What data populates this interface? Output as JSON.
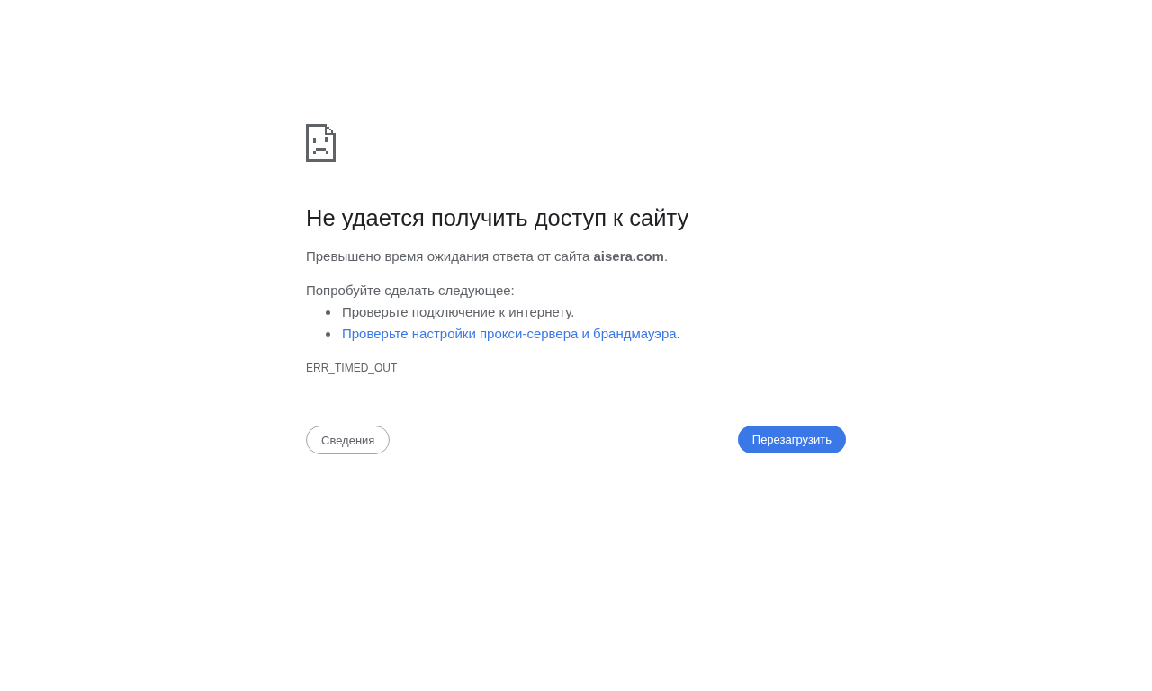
{
  "heading": "Не удается получить доступ к сайту",
  "summary": "Превышено время ожидания ответа от сайта **aisera.com**.",
  "suggestions": {
    "intro": "Попробуйте сделать следующее:",
    "items": [
      {
        "kind": "text",
        "text": "Проверьте подключение к интернету."
      },
      {
        "kind": "link",
        "text": "Проверьте настройки прокси-сервера и брандмауэра",
        "suffix": "."
      }
    ]
  },
  "error_code": "ERR_TIMED_OUT",
  "buttons": [
    {
      "kind": "secondary",
      "label": "Сведения"
    },
    {
      "kind": "primary",
      "label": "Перезагрузить"
    }
  ]
}
